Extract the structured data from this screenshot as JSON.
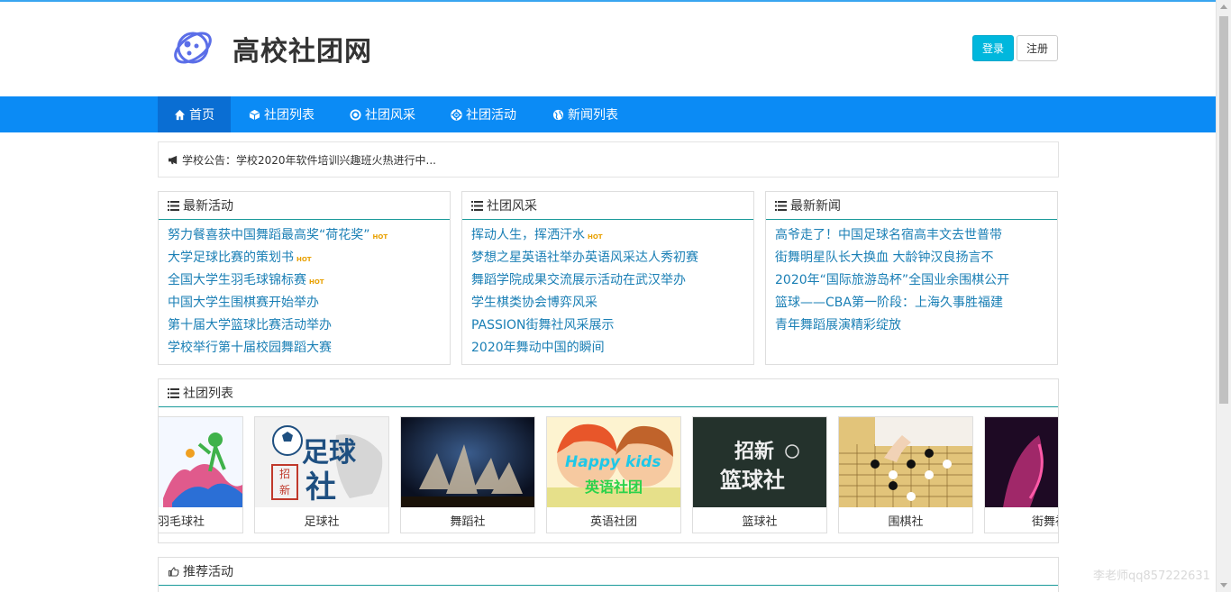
{
  "site": {
    "title": "高校社团网"
  },
  "auth": {
    "login_label": "登录",
    "register_label": "注册"
  },
  "nav": {
    "items": [
      {
        "label": "首页",
        "icon": "home-icon"
      },
      {
        "label": "社团列表",
        "icon": "cube-icon"
      },
      {
        "label": "社团风采",
        "icon": "dot-circle-icon"
      },
      {
        "label": "社团活动",
        "icon": "life-ring-icon"
      },
      {
        "label": "新闻列表",
        "icon": "globe-icon"
      }
    ]
  },
  "notice": {
    "icon": "bullhorn-icon",
    "text": "学校公告：学校2020年软件培训兴趣班火热进行中..."
  },
  "panels": {
    "latest_activities": {
      "title": "最新活动",
      "items": [
        {
          "text": "努力餐喜获中国舞蹈最高奖“荷花奖”",
          "hot": "HOT"
        },
        {
          "text": "大学足球比赛的策划书",
          "hot": "HOT"
        },
        {
          "text": "全国大学生羽毛球锦标赛",
          "hot": "HOT"
        },
        {
          "text": "中国大学生围棋赛开始举办",
          "hot": ""
        },
        {
          "text": "第十届大学篮球比赛活动举办",
          "hot": ""
        },
        {
          "text": "学校举行第十届校园舞蹈大赛",
          "hot": ""
        }
      ]
    },
    "club_style": {
      "title": "社团风采",
      "items": [
        {
          "text": "挥动人生，挥洒汗水",
          "hot": "HOT"
        },
        {
          "text": "梦想之星英语社举办英语风采达人秀初赛",
          "hot": ""
        },
        {
          "text": "舞蹈学院成果交流展示活动在武汉举办",
          "hot": ""
        },
        {
          "text": "学生棋类协会博弈风采",
          "hot": ""
        },
        {
          "text": "PASSION街舞社风采展示",
          "hot": ""
        },
        {
          "text": "2020年舞动中国的瞬间",
          "hot": ""
        }
      ]
    },
    "latest_news": {
      "title": "最新新闻",
      "items": [
        {
          "text": "高爷走了！中国足球名宿高丰文去世普带",
          "hot": ""
        },
        {
          "text": "街舞明星队长大换血 大龄钟汉良扬言不",
          "hot": ""
        },
        {
          "text": "2020年“国际旅游岛杯”全国业余围棋公开",
          "hot": ""
        },
        {
          "text": "篮球——CBA第一阶段：上海久事胜福建",
          "hot": ""
        },
        {
          "text": "青年舞蹈展演精彩绽放",
          "hot": ""
        }
      ]
    }
  },
  "club_list": {
    "title": "社团列表",
    "clubs": [
      {
        "name": "羽毛球社"
      },
      {
        "name": "足球社",
        "image_text": [
          "足球",
          "社",
          "招",
          "新"
        ]
      },
      {
        "name": "舞蹈社"
      },
      {
        "name": "英语社团",
        "image_text": [
          "Happy kids",
          "英语社团"
        ]
      },
      {
        "name": "篮球社",
        "image_text": [
          "招新",
          "篮球社"
        ]
      },
      {
        "name": "围棋社"
      },
      {
        "name": "街舞社"
      }
    ]
  },
  "recommended": {
    "title": "推荐活动"
  },
  "watermark": "李老师qq857222631",
  "colors": {
    "nav_bg": "#0b8bf5",
    "nav_active": "#0a6ed3",
    "login_btn": "#00b7dd",
    "link": "#1a7fb5",
    "hot": "#e8a000",
    "panel_rule": "#1a9a9a"
  }
}
